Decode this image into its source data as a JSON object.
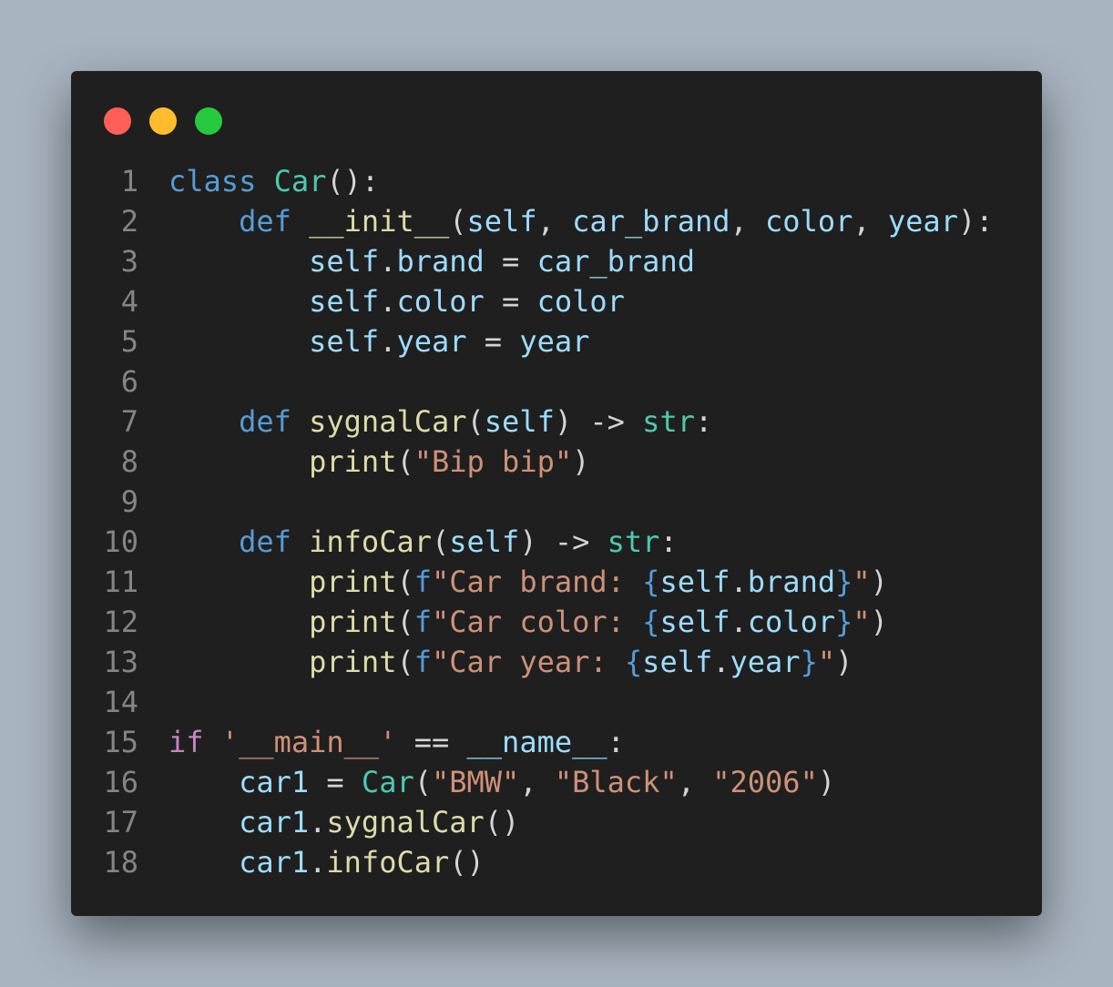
{
  "window": {
    "controls": {
      "close_color": "#ff5f56",
      "minimize_color": "#ffbd2e",
      "maximize_color": "#27c93f"
    }
  },
  "code": {
    "language": "python",
    "lines": [
      {
        "number": "1",
        "tokens": [
          {
            "t": "class",
            "c": "k"
          },
          {
            "t": " ",
            "c": "p"
          },
          {
            "t": "Car",
            "c": "c"
          },
          {
            "t": "():",
            "c": "p"
          }
        ]
      },
      {
        "number": "2",
        "tokens": [
          {
            "t": "    ",
            "c": "p"
          },
          {
            "t": "def",
            "c": "k"
          },
          {
            "t": " ",
            "c": "p"
          },
          {
            "t": "__init__",
            "c": "f"
          },
          {
            "t": "(",
            "c": "p"
          },
          {
            "t": "self",
            "c": "v"
          },
          {
            "t": ", ",
            "c": "p"
          },
          {
            "t": "car_brand",
            "c": "v"
          },
          {
            "t": ", ",
            "c": "p"
          },
          {
            "t": "color",
            "c": "v"
          },
          {
            "t": ", ",
            "c": "p"
          },
          {
            "t": "year",
            "c": "v"
          },
          {
            "t": "):",
            "c": "p"
          }
        ]
      },
      {
        "number": "3",
        "tokens": [
          {
            "t": "        ",
            "c": "p"
          },
          {
            "t": "self",
            "c": "v"
          },
          {
            "t": ".",
            "c": "p"
          },
          {
            "t": "brand",
            "c": "v"
          },
          {
            "t": " = ",
            "c": "p"
          },
          {
            "t": "car_brand",
            "c": "v"
          }
        ]
      },
      {
        "number": "4",
        "tokens": [
          {
            "t": "        ",
            "c": "p"
          },
          {
            "t": "self",
            "c": "v"
          },
          {
            "t": ".",
            "c": "p"
          },
          {
            "t": "color",
            "c": "v"
          },
          {
            "t": " = ",
            "c": "p"
          },
          {
            "t": "color",
            "c": "v"
          }
        ]
      },
      {
        "number": "5",
        "tokens": [
          {
            "t": "        ",
            "c": "p"
          },
          {
            "t": "self",
            "c": "v"
          },
          {
            "t": ".",
            "c": "p"
          },
          {
            "t": "year",
            "c": "v"
          },
          {
            "t": " = ",
            "c": "p"
          },
          {
            "t": "year",
            "c": "v"
          }
        ]
      },
      {
        "number": "6",
        "tokens": []
      },
      {
        "number": "7",
        "tokens": [
          {
            "t": "    ",
            "c": "p"
          },
          {
            "t": "def",
            "c": "k"
          },
          {
            "t": " ",
            "c": "p"
          },
          {
            "t": "sygnalCar",
            "c": "f"
          },
          {
            "t": "(",
            "c": "p"
          },
          {
            "t": "self",
            "c": "v"
          },
          {
            "t": ") -> ",
            "c": "p"
          },
          {
            "t": "str",
            "c": "c"
          },
          {
            "t": ":",
            "c": "p"
          }
        ]
      },
      {
        "number": "8",
        "tokens": [
          {
            "t": "        ",
            "c": "p"
          },
          {
            "t": "print",
            "c": "f"
          },
          {
            "t": "(",
            "c": "p"
          },
          {
            "t": "\"Bip bip\"",
            "c": "s"
          },
          {
            "t": ")",
            "c": "p"
          }
        ]
      },
      {
        "number": "9",
        "tokens": []
      },
      {
        "number": "10",
        "tokens": [
          {
            "t": "    ",
            "c": "p"
          },
          {
            "t": "def",
            "c": "k"
          },
          {
            "t": " ",
            "c": "p"
          },
          {
            "t": "infoCar",
            "c": "f"
          },
          {
            "t": "(",
            "c": "p"
          },
          {
            "t": "self",
            "c": "v"
          },
          {
            "t": ") -> ",
            "c": "p"
          },
          {
            "t": "str",
            "c": "c"
          },
          {
            "t": ":",
            "c": "p"
          }
        ]
      },
      {
        "number": "11",
        "tokens": [
          {
            "t": "        ",
            "c": "p"
          },
          {
            "t": "print",
            "c": "f"
          },
          {
            "t": "(",
            "c": "p"
          },
          {
            "t": "f",
            "c": "k"
          },
          {
            "t": "\"Car brand: ",
            "c": "s"
          },
          {
            "t": "{",
            "c": "k"
          },
          {
            "t": "self",
            "c": "v"
          },
          {
            "t": ".",
            "c": "p"
          },
          {
            "t": "brand",
            "c": "v"
          },
          {
            "t": "}",
            "c": "k"
          },
          {
            "t": "\"",
            "c": "s"
          },
          {
            "t": ")",
            "c": "p"
          }
        ]
      },
      {
        "number": "12",
        "tokens": [
          {
            "t": "        ",
            "c": "p"
          },
          {
            "t": "print",
            "c": "f"
          },
          {
            "t": "(",
            "c": "p"
          },
          {
            "t": "f",
            "c": "k"
          },
          {
            "t": "\"Car color: ",
            "c": "s"
          },
          {
            "t": "{",
            "c": "k"
          },
          {
            "t": "self",
            "c": "v"
          },
          {
            "t": ".",
            "c": "p"
          },
          {
            "t": "color",
            "c": "v"
          },
          {
            "t": "}",
            "c": "k"
          },
          {
            "t": "\"",
            "c": "s"
          },
          {
            "t": ")",
            "c": "p"
          }
        ]
      },
      {
        "number": "13",
        "tokens": [
          {
            "t": "        ",
            "c": "p"
          },
          {
            "t": "print",
            "c": "f"
          },
          {
            "t": "(",
            "c": "p"
          },
          {
            "t": "f",
            "c": "k"
          },
          {
            "t": "\"Car year: ",
            "c": "s"
          },
          {
            "t": "{",
            "c": "k"
          },
          {
            "t": "self",
            "c": "v"
          },
          {
            "t": ".",
            "c": "p"
          },
          {
            "t": "year",
            "c": "v"
          },
          {
            "t": "}",
            "c": "k"
          },
          {
            "t": "\"",
            "c": "s"
          },
          {
            "t": ")",
            "c": "p"
          }
        ]
      },
      {
        "number": "14",
        "tokens": []
      },
      {
        "number": "15",
        "tokens": [
          {
            "t": "if",
            "c": "kc"
          },
          {
            "t": " ",
            "c": "p"
          },
          {
            "t": "'__main__'",
            "c": "s"
          },
          {
            "t": " == ",
            "c": "p"
          },
          {
            "t": "__name__",
            "c": "v"
          },
          {
            "t": ":",
            "c": "p"
          }
        ]
      },
      {
        "number": "16",
        "tokens": [
          {
            "t": "    ",
            "c": "p"
          },
          {
            "t": "car1",
            "c": "v"
          },
          {
            "t": " = ",
            "c": "p"
          },
          {
            "t": "Car",
            "c": "c"
          },
          {
            "t": "(",
            "c": "p"
          },
          {
            "t": "\"BMW\"",
            "c": "s"
          },
          {
            "t": ", ",
            "c": "p"
          },
          {
            "t": "\"Black\"",
            "c": "s"
          },
          {
            "t": ", ",
            "c": "p"
          },
          {
            "t": "\"2006\"",
            "c": "s"
          },
          {
            "t": ")",
            "c": "p"
          }
        ]
      },
      {
        "number": "17",
        "tokens": [
          {
            "t": "    ",
            "c": "p"
          },
          {
            "t": "car1",
            "c": "v"
          },
          {
            "t": ".",
            "c": "p"
          },
          {
            "t": "sygnalCar",
            "c": "f"
          },
          {
            "t": "()",
            "c": "p"
          }
        ]
      },
      {
        "number": "18",
        "tokens": [
          {
            "t": "    ",
            "c": "p"
          },
          {
            "t": "car1",
            "c": "v"
          },
          {
            "t": ".",
            "c": "p"
          },
          {
            "t": "infoCar",
            "c": "f"
          },
          {
            "t": "()",
            "c": "p"
          }
        ]
      }
    ]
  }
}
